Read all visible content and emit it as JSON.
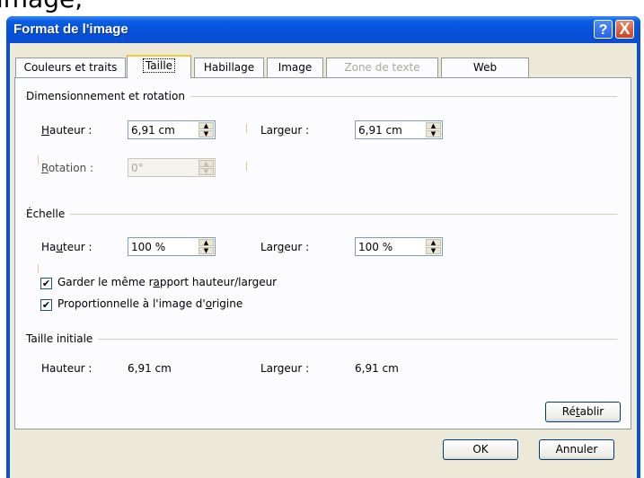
{
  "topstrip_text": "image, ",
  "window": {
    "title": "Format de l'image"
  },
  "titlebar_buttons": {
    "help": "?",
    "close": "X"
  },
  "tabs": [
    {
      "label": "Couleurs et traits",
      "state": "normal"
    },
    {
      "label": "Taille",
      "state": "active"
    },
    {
      "label": "Habillage",
      "state": "normal"
    },
    {
      "label": "Image",
      "state": "normal"
    },
    {
      "label": "Zone de texte",
      "state": "disabled"
    },
    {
      "label": "Web",
      "state": "normal"
    }
  ],
  "sections": {
    "size_rotation": {
      "title": "Dimensionnement et rotation",
      "height": {
        "pre": "",
        "key": "H",
        "post": "auteur :",
        "value": "6,91 cm"
      },
      "width": {
        "pre": "Lar",
        "key": "g",
        "post": "eur :",
        "value": "6,91 cm"
      },
      "rotation": {
        "pre": "",
        "key": "R",
        "post": "otation :",
        "value": "0°"
      }
    },
    "scale": {
      "title": "Échelle",
      "height": {
        "pre": "Ha",
        "key": "u",
        "post": "teur :",
        "value": "100 %"
      },
      "width": {
        "pre": "Lar",
        "key": "g",
        "post": "eur :",
        "value": "100 %"
      },
      "lock_ratio": {
        "pre": "Garder le même r",
        "key": "a",
        "post": "pport hauteur/largeur",
        "checked": true
      },
      "relative_original": {
        "pre": "Proportionnelle à l'image d'",
        "key": "o",
        "post": "rigine",
        "checked": true
      }
    },
    "original_size": {
      "title": "Taille initiale",
      "height_label": "Hauteur :",
      "height_value": "6,91 cm",
      "width_label": "Largeur :",
      "width_value": "6,91 cm"
    }
  },
  "buttons": {
    "reset": {
      "pre": "Ré",
      "key": "t",
      "post": "ablir"
    },
    "ok": "OK",
    "cancel": "Annuler"
  },
  "colors": {
    "titlebar": "#0650d8",
    "dialog_bg": "#ece9d8",
    "panel_bg": "#fcfcfe",
    "tab_active_accent": "#ffc83c"
  }
}
